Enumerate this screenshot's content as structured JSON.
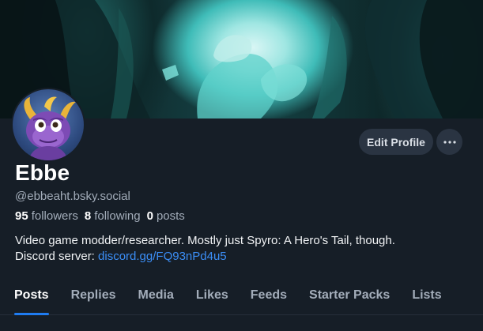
{
  "profile": {
    "display_name": "Ebbe",
    "handle": "@ebbeaht.bsky.social",
    "followers_count": "95",
    "followers_label": "followers",
    "following_count": "8",
    "following_label": "following",
    "posts_count": "0",
    "posts_label": "posts",
    "bio_line1": "Video game modder/researcher. Mostly just Spyro: A Hero's Tail, though.",
    "bio_line2_prefix": "Discord server:",
    "bio_link": "discord.gg/FQ93nPd4u5"
  },
  "actions": {
    "edit_profile_label": "Edit Profile",
    "more_icon": "more-horizontal-icon"
  },
  "tabs": [
    {
      "label": "Posts",
      "active": true
    },
    {
      "label": "Replies",
      "active": false
    },
    {
      "label": "Media",
      "active": false
    },
    {
      "label": "Likes",
      "active": false
    },
    {
      "label": "Feeds",
      "active": false
    },
    {
      "label": "Starter Packs",
      "active": false
    },
    {
      "label": "Lists",
      "active": false
    }
  ],
  "colors": {
    "background": "#161e27",
    "button_bg": "#2a3442",
    "muted_text": "#a3adba",
    "link": "#3b8ef6",
    "tab_indicator": "#1f7cf1"
  }
}
